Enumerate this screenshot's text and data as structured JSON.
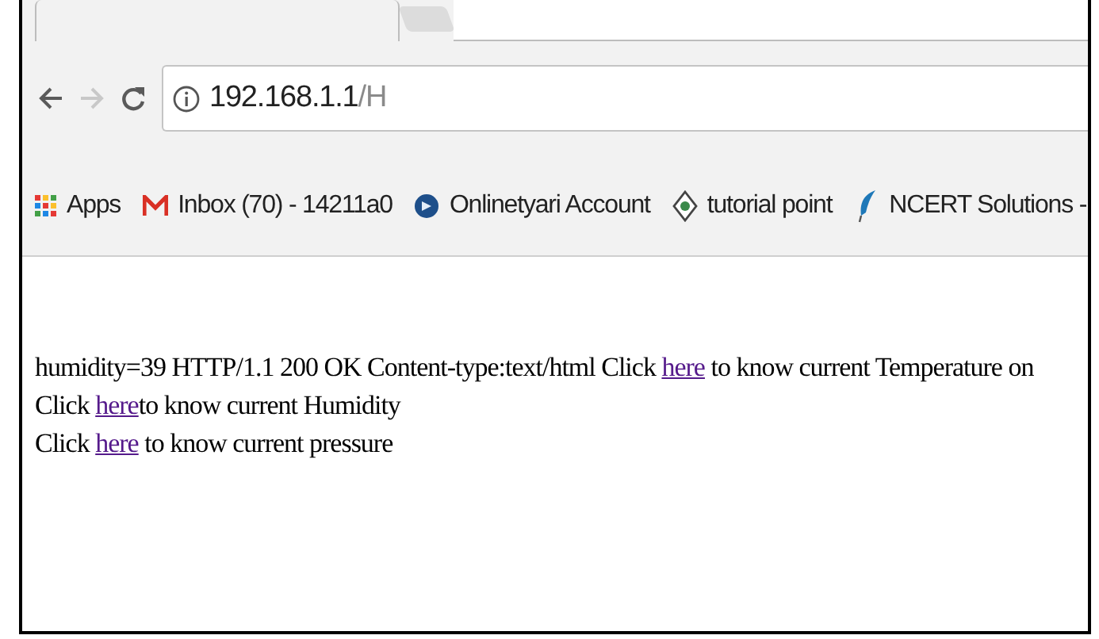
{
  "address_bar": {
    "host": "192.168.1.1",
    "path": "/H"
  },
  "bookmarks": [
    {
      "kind": "apps",
      "label": "Apps"
    },
    {
      "kind": "mail",
      "label": "Inbox (70) - 14211a0"
    },
    {
      "kind": "round",
      "label": "Onlinetyari Account"
    },
    {
      "kind": "diamond",
      "label": "tutorial point"
    },
    {
      "kind": "feather",
      "label": "NCERT Solutions -"
    }
  ],
  "page_lines": [
    [
      {
        "text": "humidity=39 HTTP/1.1 200 OK Content-type:text/html Click "
      },
      {
        "link": "here"
      },
      {
        "text": " to know current Temperature on"
      }
    ],
    [
      {
        "text": "Click "
      },
      {
        "link": "here"
      },
      {
        "text": "to know current Humidity"
      }
    ],
    [
      {
        "text": "Click "
      },
      {
        "link": "here"
      },
      {
        "text": " to know current pressure"
      }
    ]
  ]
}
